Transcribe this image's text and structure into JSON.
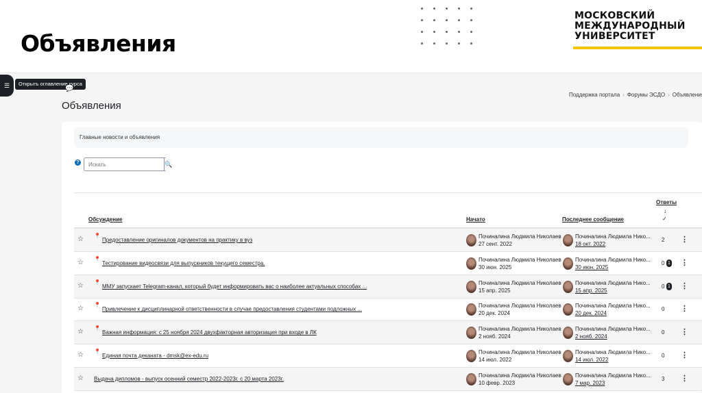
{
  "slide": {
    "title": "Объявления",
    "logo_lines": [
      "МОСКОВСКИЙ",
      "МЕЖДУНАРОДНЫЙ",
      "УНИВЕРСИТЕТ"
    ],
    "brand_color": "#f5c400"
  },
  "drawer": {
    "icon": "list-icon",
    "tooltip": "Открыть оглавление курса"
  },
  "breadcrumb": [
    "Поддержка портала",
    "Форумы ЭСДО",
    "Объявления"
  ],
  "page": {
    "heading": "Объявления"
  },
  "forum": {
    "description": "Главные новости и объявления"
  },
  "search": {
    "placeholder": "Искать",
    "help": "?"
  },
  "table": {
    "headers": {
      "discussion": "Обсуждение",
      "started": "Начато",
      "last_post": "Последнее сообщение",
      "replies": "Ответы",
      "sort_icon": "↓",
      "check_icon": "✓"
    },
    "rows": [
      {
        "pinned": true,
        "topic": "Предоставление оригиналов документов на практику в вуз",
        "author": "Починалина Людмила Николаев",
        "started": "27 сент. 2022",
        "last_author": "Починалина Людмила Нико...",
        "last_date": "18 окт. 2022",
        "replies": "2",
        "unread": ""
      },
      {
        "pinned": true,
        "topic": "Тестирование видеосвязи для выпускников текущего семестра.",
        "author": "Починалина Людмила Николаев",
        "started": "30 июн. 2025",
        "last_author": "Починалина Людмила Нико...",
        "last_date": "30 июн. 2025",
        "replies": "0",
        "unread": "1"
      },
      {
        "pinned": true,
        "topic": "ММУ запускает Telegram-канал, который будет информировать вас о наиболее актуальных способах ...",
        "author": "Починалина Людмила Николаев",
        "started": "15 апр. 2025",
        "last_author": "Починалина Людмила Нико...",
        "last_date": "15 апр. 2025",
        "replies": "0",
        "unread": "1"
      },
      {
        "pinned": true,
        "topic": "Привлечение к дисциплинарной ответственности в случае предоставления студентами подложных ...",
        "author": "Починалина Людмила Николаев",
        "started": "20 дек. 2024",
        "last_author": "Починалина Людмила Нико...",
        "last_date": "20 дек. 2024",
        "replies": "0",
        "unread": ""
      },
      {
        "pinned": true,
        "topic": "Важная информация: с 25 ноября 2024 двухфакторная авторизация при входе в ЛК",
        "author": "Починалина Людмила Николаев",
        "started": "2 нояб. 2024",
        "last_author": "Починалина Людмила Нико...",
        "last_date": "2 нояб. 2024",
        "replies": "0",
        "unread": ""
      },
      {
        "pinned": true,
        "topic": "Единая почта деканата - dmsk@ex-edu.ru",
        "author": "Починалина Людмила Николаев",
        "started": "14 июл. 2022",
        "last_author": "Починалина Людмила Нико...",
        "last_date": "14 июл. 2022",
        "replies": "0",
        "unread": ""
      },
      {
        "pinned": false,
        "topic": "Выдача дипломов - выпуск осенний семестр 2022-2023г. с 20 марта 2023г.",
        "author": "Починалина Людмила Николаев",
        "started": "10 февр. 2023",
        "last_author": "Починалина Людмила Нико...",
        "last_date": "7 мар. 2023",
        "replies": "3",
        "unread": ""
      }
    ]
  }
}
